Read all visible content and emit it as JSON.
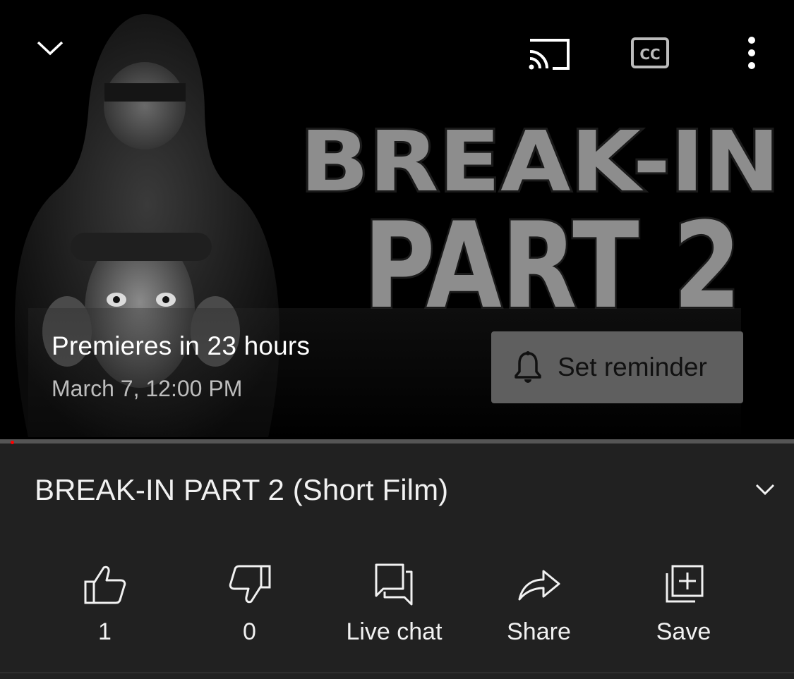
{
  "player": {
    "premiere_text": "Premieres in 23 hours",
    "premiere_date": "March 7, 12:00 PM",
    "set_reminder_label": "Set reminder",
    "thumbnail_text": {
      "line1": "BREAK-IN",
      "line2": "PART 2"
    },
    "progress_fraction": 0.0
  },
  "video": {
    "title": "BREAK-IN PART 2 (Short Film)"
  },
  "actions": [
    {
      "name": "like",
      "icon": "thumbs-up-icon",
      "label": "1"
    },
    {
      "name": "dislike",
      "icon": "thumbs-down-icon",
      "label": "0"
    },
    {
      "name": "live-chat",
      "icon": "chat-icon",
      "label": "Live chat"
    },
    {
      "name": "share",
      "icon": "share-arrow-icon",
      "label": "Share"
    },
    {
      "name": "save",
      "icon": "add-to-playlist-icon",
      "label": "Save"
    }
  ],
  "colors": {
    "background": "#212121",
    "player_background": "#000000",
    "accent_red": "#ff0000",
    "reminder_button": "#5f5f5f"
  }
}
